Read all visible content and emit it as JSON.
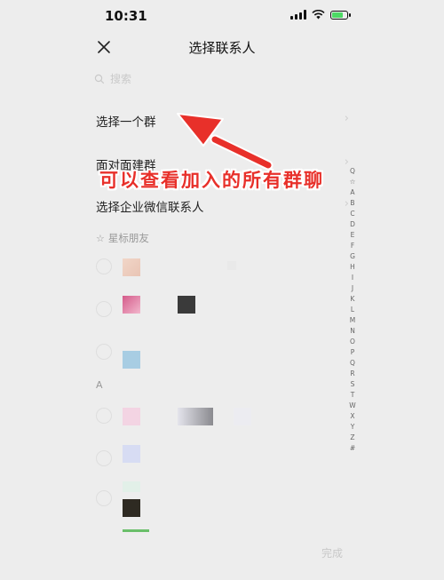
{
  "status_bar": {
    "time": "10:31"
  },
  "nav": {
    "title": "选择联系人"
  },
  "search": {
    "placeholder": "搜索"
  },
  "menu": [
    {
      "label": "选择一个群"
    },
    {
      "label": "面对面建群"
    },
    {
      "label": "选择企业微信联系人"
    }
  ],
  "annotation": {
    "text": "可以查看加入的所有群聊",
    "color": "#e8302a"
  },
  "starred": {
    "label": "星标朋友"
  },
  "section_letter": "A",
  "alpha_index": [
    "Q",
    "☆",
    "A",
    "B",
    "C",
    "D",
    "E",
    "F",
    "G",
    "H",
    "I",
    "J",
    "K",
    "L",
    "M",
    "N",
    "O",
    "P",
    "Q",
    "R",
    "S",
    "T",
    "W",
    "X",
    "Y",
    "Z",
    "#"
  ],
  "done_label": "完成",
  "colors": {
    "background": "#ededed",
    "accent_red": "#e8302a",
    "chevron": "#cfcfcf"
  }
}
